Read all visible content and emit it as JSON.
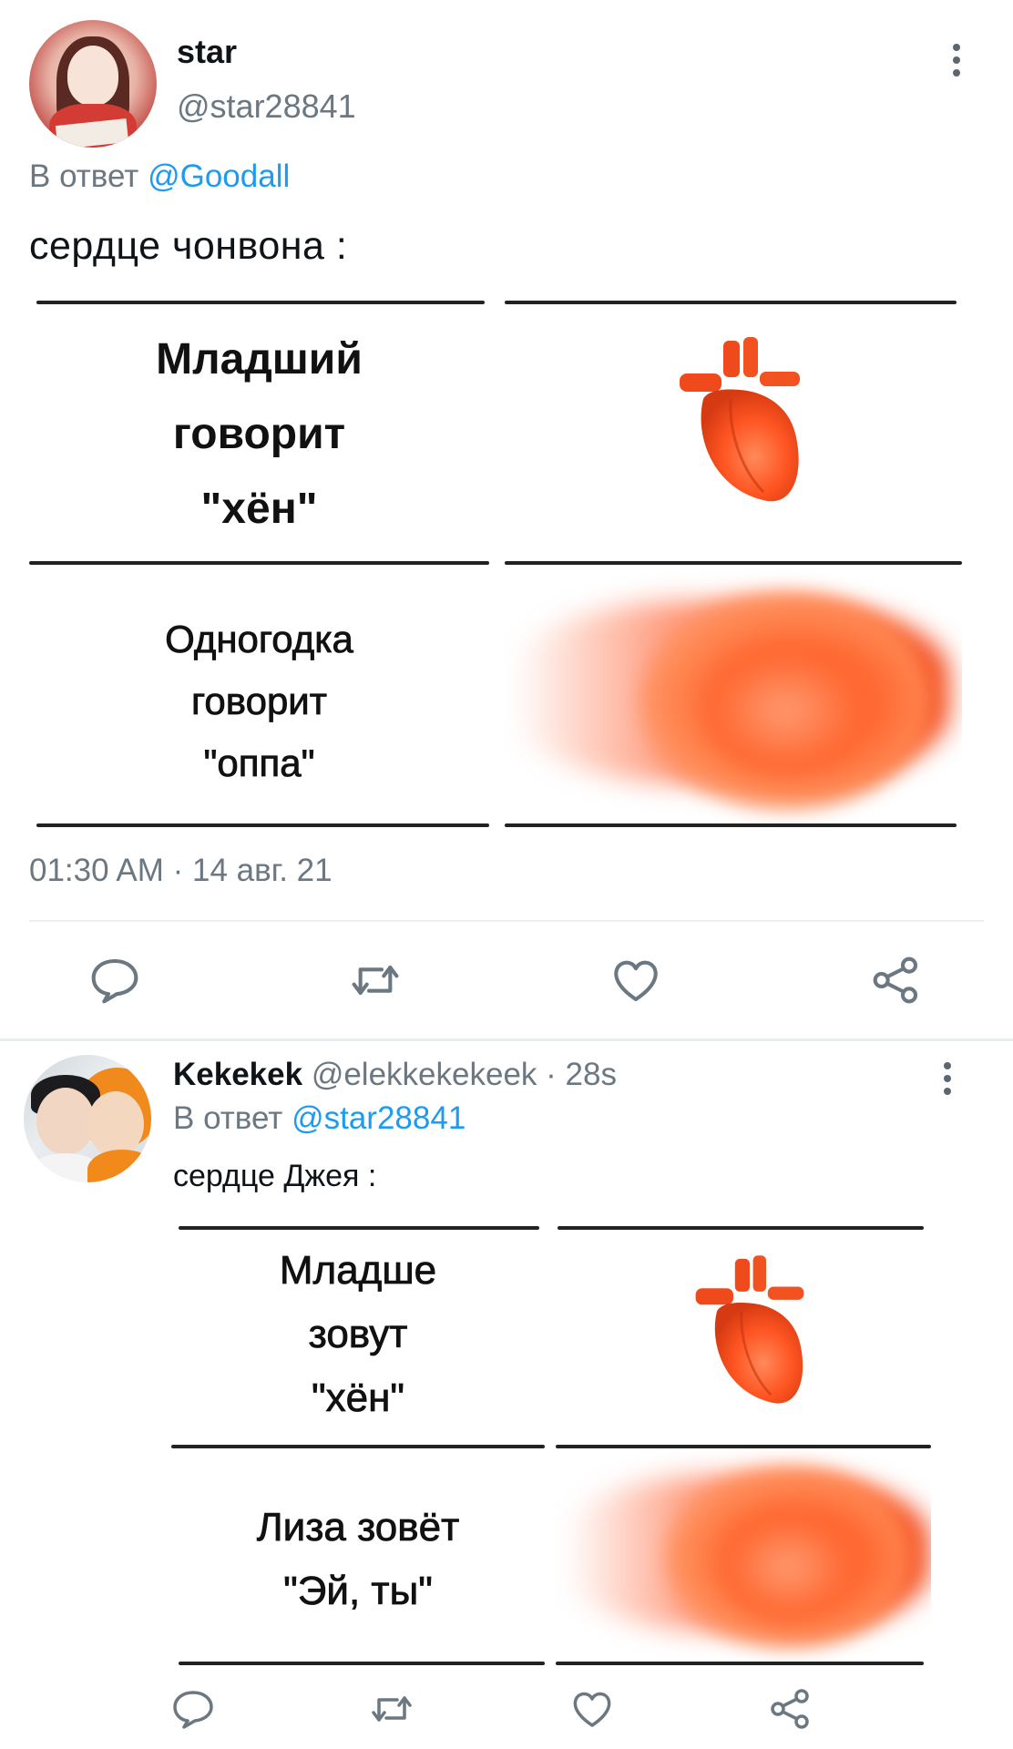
{
  "tweet1": {
    "name": "star",
    "handle": "@star28841",
    "reply_prefix": "В ответ",
    "reply_to": "@Goodall",
    "text": "сердце чонвона :",
    "meme": {
      "top_caption": [
        "Младший",
        "говорит",
        "\"хён\""
      ],
      "bottom_caption": [
        "Одногодка",
        "говорит",
        "\"оппа\""
      ]
    },
    "timestamp": "01:30 AM · 14 авг. 21"
  },
  "tweet2": {
    "name": "Kekekek",
    "handle": "@elekkekekeek",
    "time": "· 28s",
    "reply_prefix": "В ответ",
    "reply_to": "@star28841",
    "text": "сердце Джея :",
    "meme": {
      "top_caption": [
        "Младше",
        "зовут",
        "\"хён\""
      ],
      "bottom_caption": [
        "Лиза зовёт",
        "\"Эй, ты\""
      ]
    }
  },
  "actions": [
    "reply-icon",
    "retweet-icon",
    "like-icon",
    "share-icon"
  ],
  "colors": {
    "accent": "#1d9bf0",
    "secondary_text": "#6b7781",
    "heart": "#ff5a26"
  }
}
